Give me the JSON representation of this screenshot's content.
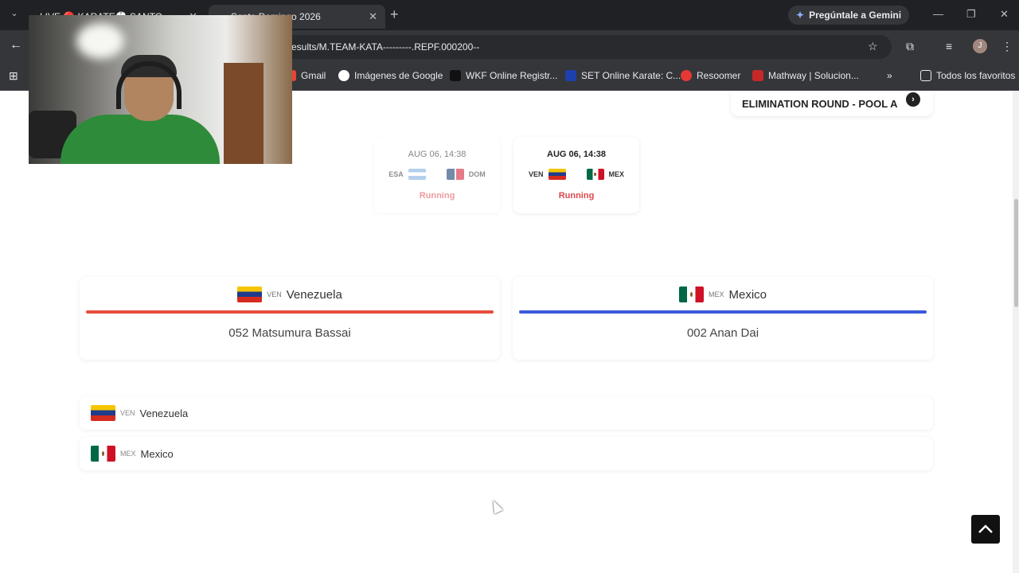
{
  "browser": {
    "tabs": [
      {
        "label": "LIVE 🔴 KARATE🥋 SANTO"
      },
      {
        "label": "Santo Domingo 2026"
      }
    ],
    "gemini_label": "Pregúntale a Gemini",
    "url": "esults/M.TEAM-KATA---------.REPF.000200--",
    "profile_initial": "J",
    "bookmarks": [
      {
        "label": "Gmail"
      },
      {
        "label": "Imágenes de Google"
      },
      {
        "label": "WKF Online Registr..."
      },
      {
        "label": "SET Online Karate: C..."
      },
      {
        "label": "Resoomer"
      },
      {
        "label": "Mathway | Solucion..."
      }
    ],
    "all_bookmarks_label": "Todos los favoritos"
  },
  "page": {
    "round_label": "ELIMINATION ROUND - POOL A",
    "matches": [
      {
        "time": "AUG 06, 14:38",
        "team1": "ESA",
        "team2": "DOM",
        "state": "Running"
      },
      {
        "time": "AUG 06, 14:38",
        "team1": "VEN",
        "team2": "MEX",
        "state": "Running"
      }
    ],
    "competitors": [
      {
        "code": "VEN",
        "country": "Venezuela",
        "kata": "052 Matsumura Bassai",
        "color": "#e74c3c"
      },
      {
        "code": "MEX",
        "country": "Mexico",
        "kata": "002 Anan Dai",
        "color": "#3b5bdb"
      }
    ],
    "ranking": [
      {
        "code": "VEN",
        "country": "Venezuela"
      },
      {
        "code": "MEX",
        "country": "Mexico"
      }
    ]
  },
  "icons": {
    "back": "arrow-left-icon",
    "star": "star-icon",
    "to_top": "chevron-up-icon"
  }
}
